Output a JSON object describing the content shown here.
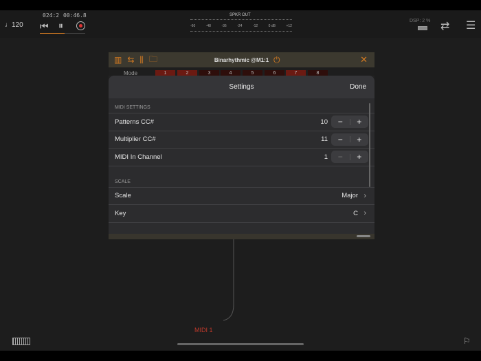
{
  "transport": {
    "tempo": "♩120",
    "position": "024:2",
    "time": "00:46.8"
  },
  "meter": {
    "label": "SPKR OUT",
    "ticks": [
      "-60",
      "-48",
      "-36",
      "-24",
      "-12",
      "0 dB",
      "+12"
    ]
  },
  "dsp": {
    "label": "DSP: 2 %"
  },
  "plugin": {
    "title": "Binarhythmic @M1:1",
    "mode_label": "Mode",
    "mode_cells": [
      "1",
      "2",
      "3",
      "4",
      "5",
      "6",
      "7",
      "8"
    ],
    "active_cells": [
      true,
      true,
      false,
      false,
      false,
      false,
      true,
      false
    ]
  },
  "settings": {
    "title": "Settings",
    "done": "Done",
    "midi_section": "MIDI SETTINGS",
    "midi_rows": [
      {
        "label": "Patterns CC#",
        "value": "10"
      },
      {
        "label": "Multiplier CC#",
        "value": "11"
      },
      {
        "label": "MIDI In Channel",
        "value": "1"
      }
    ],
    "scale_section": "SCALE",
    "scale_rows": [
      {
        "label": "Scale",
        "value": "Major"
      },
      {
        "label": "Key",
        "value": "C"
      }
    ],
    "minus": "−",
    "plus": "+"
  },
  "node": {
    "label": "MIDI 1"
  },
  "colors": {
    "accent": "#d57b22",
    "midi_red": "#c0392b"
  }
}
